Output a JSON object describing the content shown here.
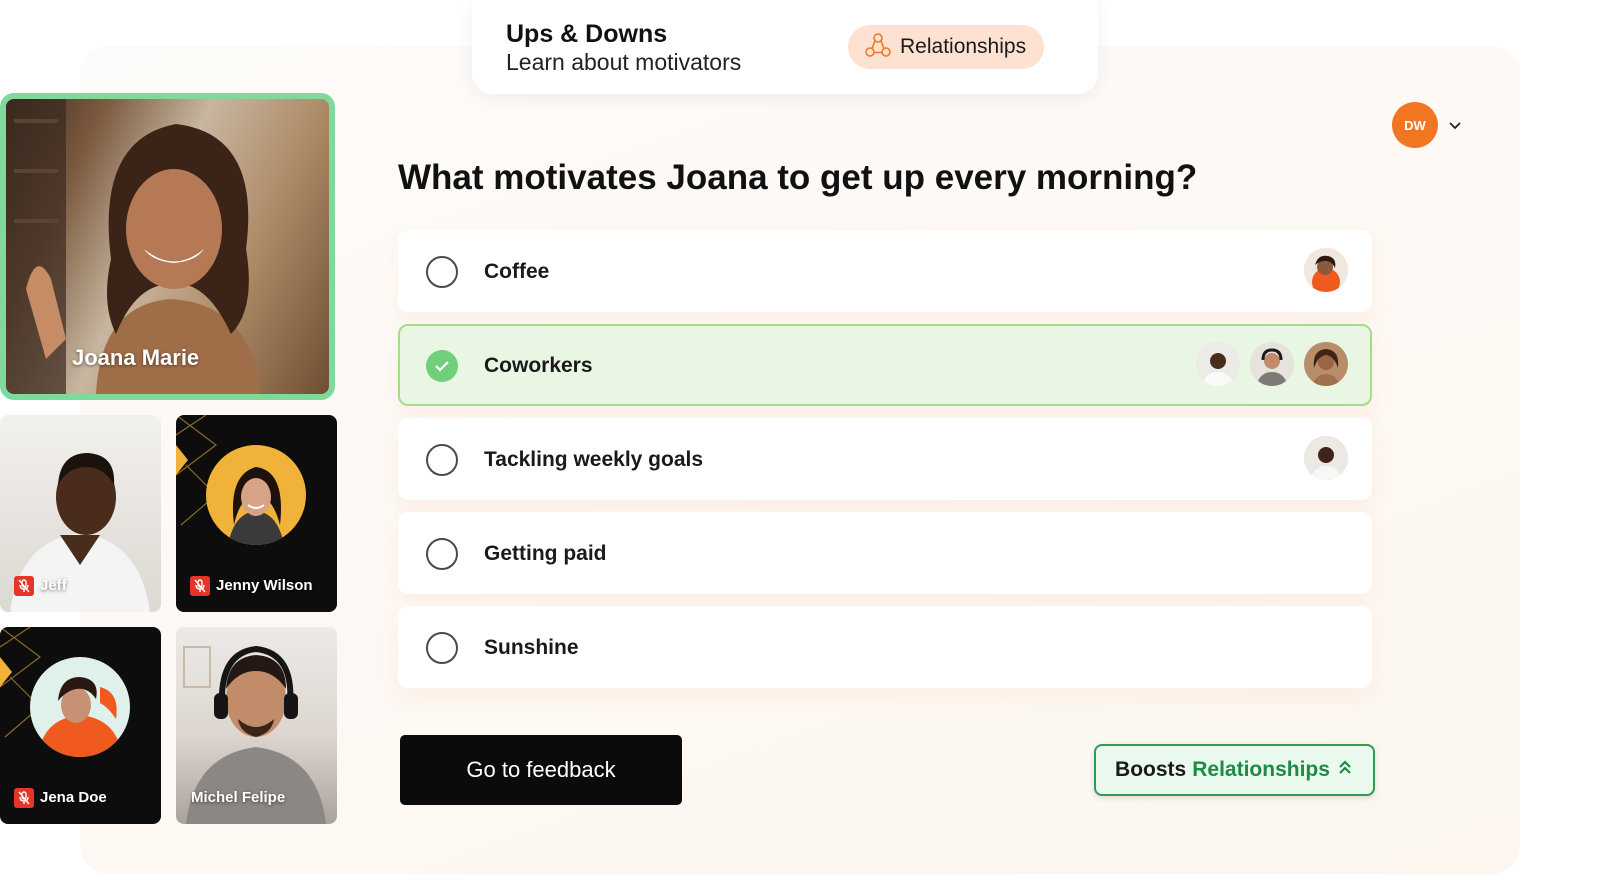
{
  "activity": {
    "title": "Ups & Downs",
    "subtitle": "Learn about motivators",
    "category_label": "Relationships",
    "category_icon": "relationships-icon"
  },
  "user": {
    "initials": "DW",
    "avatar_color": "#f27622"
  },
  "question": "What motivates Joana to get up every morning?",
  "options": [
    {
      "label": "Coffee",
      "selected": false,
      "voters": 1
    },
    {
      "label": "Coworkers",
      "selected": true,
      "voters": 3
    },
    {
      "label": "Tackling weekly goals",
      "selected": false,
      "voters": 1
    },
    {
      "label": "Getting paid",
      "selected": false,
      "voters": 0
    },
    {
      "label": "Sunshine",
      "selected": false,
      "voters": 0
    }
  ],
  "actions": {
    "go_feedback_label": "Go to feedback",
    "boosts_prefix": "Boosts",
    "boosts_category": "Relationships"
  },
  "participants": {
    "main": {
      "name": "Joana Marie",
      "speaking": true,
      "highlight_color": "#7ed99a"
    },
    "tiles": [
      {
        "name": "Jeff",
        "muted": true
      },
      {
        "name": "Jenny Wilson",
        "muted": true
      },
      {
        "name": "Jena Doe",
        "muted": true
      },
      {
        "name": "Michel Felipe",
        "muted": false
      }
    ]
  },
  "colors": {
    "accent_orange": "#f27622",
    "selected_bg": "#eaf6e4",
    "selected_border": "#a5dc8a",
    "check_green": "#6fcf7a",
    "boost_green": "#1e8a44",
    "mute_red": "#e5352b"
  }
}
